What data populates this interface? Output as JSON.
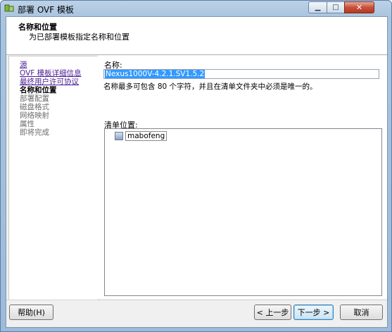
{
  "window": {
    "title": "部署 OVF 模板",
    "controls": {
      "minimize": "▁",
      "maximize": "□",
      "close": "✕"
    }
  },
  "header": {
    "title": "名称和位置",
    "subtitle": "为已部署模板指定名称和位置"
  },
  "nav": {
    "items": [
      {
        "label": "源",
        "state": "link"
      },
      {
        "label": "OVF 模板详细信息",
        "state": "link"
      },
      {
        "label": "最终用户许可协议",
        "state": "link"
      },
      {
        "label": "名称和位置",
        "state": "current"
      },
      {
        "label": "部署配置",
        "state": "future"
      },
      {
        "label": "磁盘格式",
        "state": "future"
      },
      {
        "label": "网络映射",
        "state": "future"
      },
      {
        "label": "属性",
        "state": "future"
      },
      {
        "label": "即将完成",
        "state": "future"
      }
    ]
  },
  "content": {
    "name_label": "名称:",
    "name_value": "Nexus1000V-4.2.1.SV1.5.2",
    "name_hint": "名称最多可包含 80 个字符，并且在清单文件夹中必须是唯一的。",
    "inventory_label": "清单位置:",
    "tree": {
      "nodes": [
        {
          "label": "mabofeng",
          "icon": "datacenter-icon"
        }
      ]
    }
  },
  "footer": {
    "help_label": "帮助(H)",
    "back_label": "< 上一步",
    "next_label": "下一步 >",
    "cancel_label": "取消"
  }
}
